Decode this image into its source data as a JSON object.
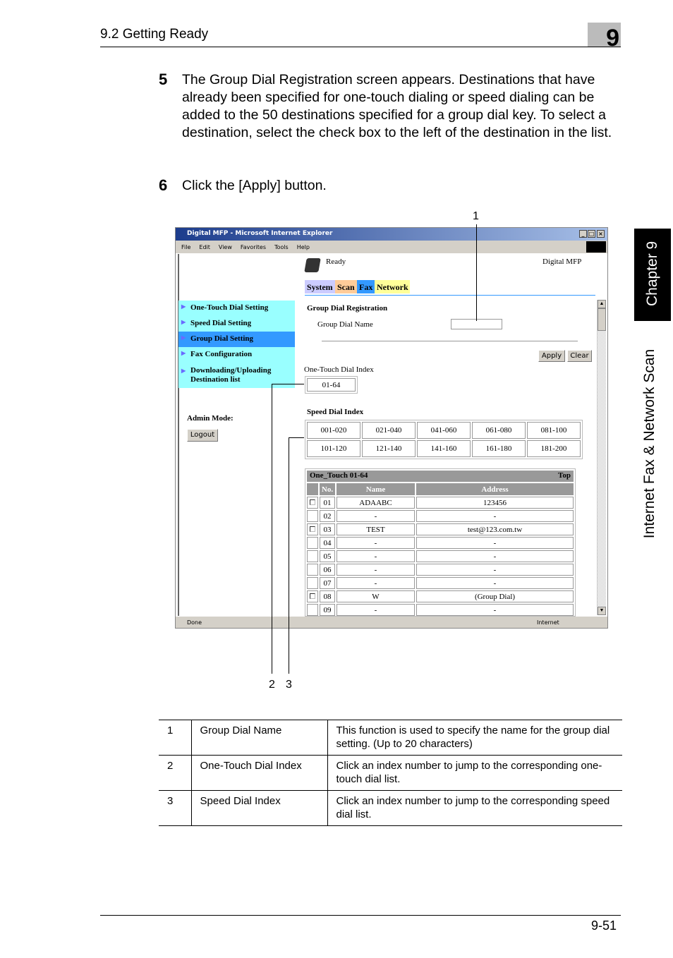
{
  "header": {
    "section": "9.2 Getting Ready",
    "chapter_number": "9"
  },
  "side_tab": {
    "chapter": "Chapter 9",
    "title": "Internet Fax & Network Scan"
  },
  "steps": [
    {
      "num": "5",
      "text": "The Group Dial Registration screen appears. Destinations that have already been specified for one-touch dialing or speed dialing can be added to the 50 destinations specified for a group dial key. To select a destination, select the check box to the left of the destination in the list."
    },
    {
      "num": "6",
      "text": "Click the [Apply] button."
    }
  ],
  "callouts": [
    "1",
    "2",
    "3"
  ],
  "browser": {
    "title": "Digital MFP - Microsoft Internet Explorer",
    "menu": [
      "File",
      "Edit",
      "View",
      "Favorites",
      "Tools",
      "Help"
    ],
    "status_left": "Done",
    "status_zone": "Internet",
    "ready": "Ready",
    "device": "Digital MFP",
    "tabs": [
      {
        "label": "System",
        "color": "#ccccff"
      },
      {
        "label": "Scan",
        "color": "#ffcc99"
      },
      {
        "label": "Fax",
        "color": "#3399ff"
      },
      {
        "label": "Network",
        "color": "#ffff99"
      }
    ],
    "sidebar": [
      "One-Touch Dial Setting",
      "Speed Dial Setting",
      "Group Dial Setting",
      "Fax Configuration",
      "Downloading/Uploading Destination list"
    ],
    "admin_mode": "Admin Mode:",
    "logout": "Logout",
    "section_title": "Group Dial Registration",
    "group_name_label": "Group Dial Name",
    "group_name_value": "",
    "apply": "Apply",
    "clear": "Clear",
    "one_touch_label": "One-Touch Dial Index",
    "one_touch_items": [
      "01-64"
    ],
    "speed_label": "Speed Dial Index",
    "speed_items": [
      "001-020",
      "021-040",
      "041-060",
      "061-080",
      "081-100",
      "101-120",
      "121-140",
      "141-160",
      "161-180",
      "181-200"
    ],
    "list": {
      "title": "One_Touch 01-64",
      "top": "Top",
      "headers": [
        "No.",
        "Name",
        "Address"
      ],
      "rows": [
        {
          "no": "01",
          "name": "ADAABC",
          "address": "123456",
          "checkbox": true
        },
        {
          "no": "02",
          "name": "-",
          "address": "-",
          "checkbox": false
        },
        {
          "no": "03",
          "name": "TEST",
          "address": "test@123.com.tw",
          "checkbox": true
        },
        {
          "no": "04",
          "name": "-",
          "address": "-",
          "checkbox": false
        },
        {
          "no": "05",
          "name": "-",
          "address": "-",
          "checkbox": false
        },
        {
          "no": "06",
          "name": "-",
          "address": "-",
          "checkbox": false
        },
        {
          "no": "07",
          "name": "-",
          "address": "-",
          "checkbox": false
        },
        {
          "no": "08",
          "name": "W",
          "address": "(Group Dial)",
          "checkbox": true
        },
        {
          "no": "09",
          "name": "-",
          "address": "-",
          "checkbox": false
        }
      ]
    }
  },
  "table": [
    {
      "num": "1",
      "item": "Group Dial Name",
      "desc": "This function is used to specify the name for the group dial setting. (Up to 20 characters)"
    },
    {
      "num": "2",
      "item": "One-Touch Dial Index",
      "desc": "Click an index number to jump to the corresponding one-touch dial list."
    },
    {
      "num": "3",
      "item": "Speed Dial Index",
      "desc": "Click an index number to jump to the corresponding speed dial list."
    }
  ],
  "footer": {
    "page": "9-51"
  }
}
